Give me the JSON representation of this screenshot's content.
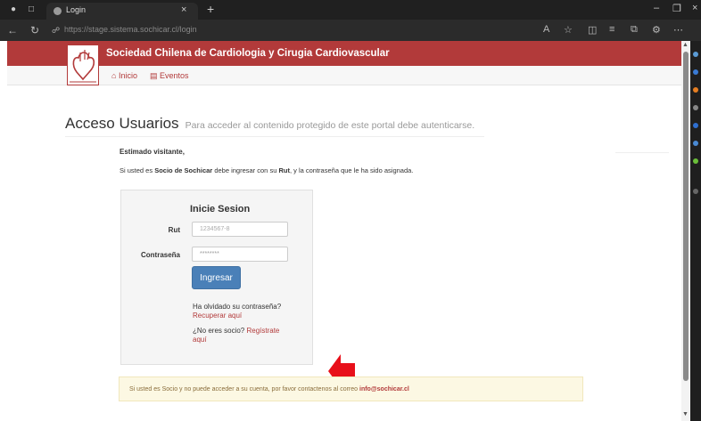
{
  "browser": {
    "tab_title": "Login",
    "new_tab_label": "+",
    "url_host": "https://stage.sistema.sochicar.cl",
    "url_path": "/login"
  },
  "site": {
    "title": "Sociedad Chilena de Cardiologia y Cirugia Cardiovascular",
    "nav": [
      {
        "label": "Inicio",
        "icon": "home-icon"
      },
      {
        "label": "Eventos",
        "icon": "calendar-icon"
      }
    ]
  },
  "main": {
    "heading": "Acceso Usuarios",
    "subheading": "Para acceder al contenido protegido de este portal debe autenticarse.",
    "greeting": "Estimado visitante,",
    "info_prefix": "Si usted es ",
    "info_bold1": "Socio de Sochicar",
    "info_mid": " debe ingresar con su ",
    "info_bold2": "Rut",
    "info_suffix": ", y la contraseña que le ha sido asignada."
  },
  "login": {
    "title": "Inicie Sesion",
    "rut_label": "Rut",
    "rut_placeholder": "1234567-8",
    "password_label": "Contraseña",
    "password_value": "********",
    "submit_label": "Ingresar",
    "forgot_text": "Ha olvidado su contraseña?",
    "recover_link": "Recuperar aquí",
    "not_member_text": "¿No eres socio? ",
    "register_link": "Regístrate aquí"
  },
  "notice": {
    "text": "Si usted es Socio y no puede acceder a su cuenta, por favor contactenos al correo ",
    "email": "info@sochicar.cl"
  },
  "colors": {
    "brand": "#b23a3a",
    "button": "#4a80b8",
    "arrow": "#e8101a"
  }
}
